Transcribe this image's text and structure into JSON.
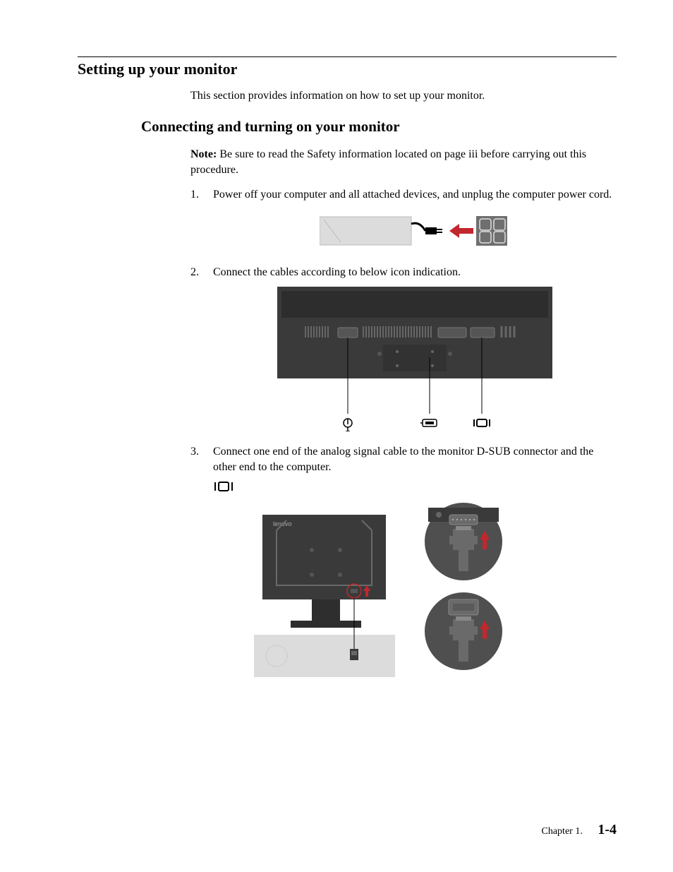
{
  "heading": {
    "h1": "Setting up your monitor",
    "intro": "This section provides information on how to set up your monitor.",
    "h2": "Connecting and turning on your monitor"
  },
  "note": {
    "label": "Note:",
    "text": "Be sure to read the Safety information located on page iii before carrying out this procedure."
  },
  "steps": {
    "s1": "Power off your computer and all attached devices, and unplug the computer power cord.",
    "s2": "Connect the cables according to below icon indication.",
    "s3": "Connect one end of the analog signal cable to the monitor D-SUB connector and the other end to the computer."
  },
  "icons": {
    "power": "power-icon",
    "dvi": "dvi-icon",
    "vga": "vga-icon"
  },
  "figure3_brand": "lenovo",
  "footer": {
    "chapter": "Chapter 1.",
    "page": "1-4"
  }
}
